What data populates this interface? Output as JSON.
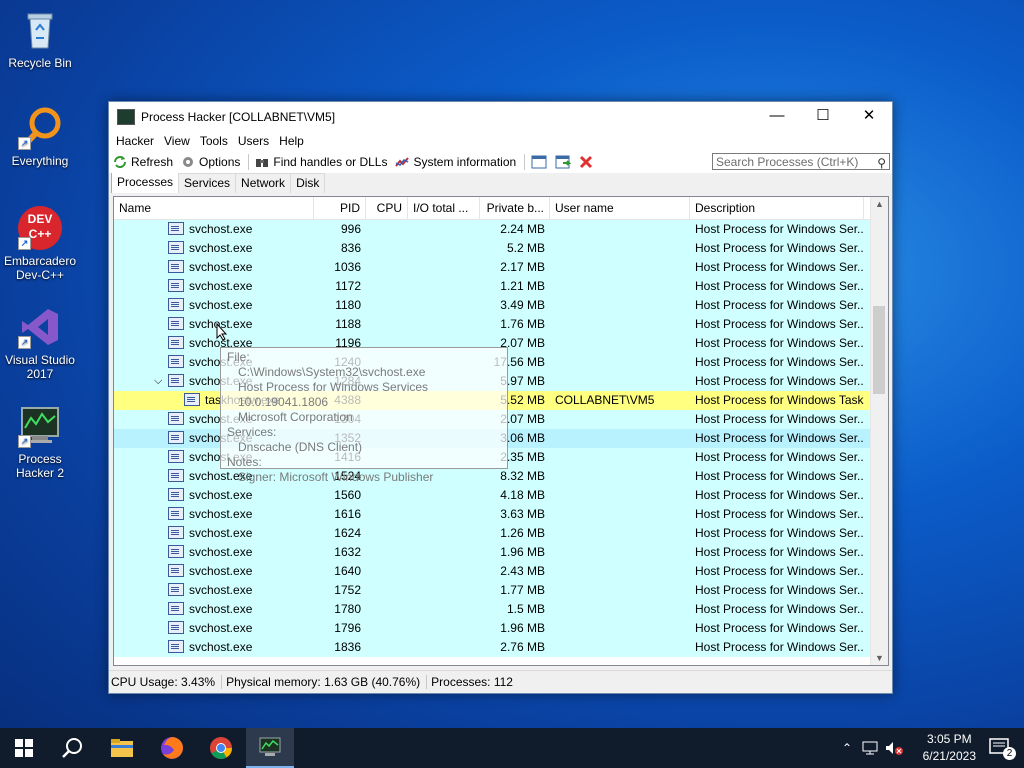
{
  "desktop": [
    {
      "label": "Recycle Bin"
    },
    {
      "label": "Everything"
    },
    {
      "label": "Embarcadero Dev-C++",
      "icon_text": "DEV C++"
    },
    {
      "label": "Visual Studio 2017"
    },
    {
      "label": "Process Hacker 2"
    }
  ],
  "window": {
    "title": "Process Hacker [COLLABNET\\VM5]",
    "controls": {
      "minimize": "—",
      "maximize": "☐",
      "close": "✕"
    }
  },
  "menu": [
    "Hacker",
    "View",
    "Tools",
    "Users",
    "Help"
  ],
  "toolbar": {
    "refresh": "Refresh",
    "options": "Options",
    "find_handles": "Find handles or DLLs",
    "system_info": "System information",
    "search_placeholder": "Search Processes (Ctrl+K)"
  },
  "tabs": [
    "Processes",
    "Services",
    "Network",
    "Disk"
  ],
  "columns": [
    "Name",
    "PID",
    "CPU",
    "I/O total ...",
    "Private b...",
    "User name",
    "Description"
  ],
  "rows": [
    {
      "name": "svchost.exe",
      "pid": "996",
      "priv": "2.24 MB",
      "user": "",
      "desc": "Host Process for Windows Ser..."
    },
    {
      "name": "svchost.exe",
      "pid": "836",
      "priv": "5.2 MB",
      "user": "",
      "desc": "Host Process for Windows Ser..."
    },
    {
      "name": "svchost.exe",
      "pid": "1036",
      "priv": "2.17 MB",
      "user": "",
      "desc": "Host Process for Windows Ser..."
    },
    {
      "name": "svchost.exe",
      "pid": "1172",
      "priv": "1.21 MB",
      "user": "",
      "desc": "Host Process for Windows Ser..."
    },
    {
      "name": "svchost.exe",
      "pid": "1180",
      "priv": "3.49 MB",
      "user": "",
      "desc": "Host Process for Windows Ser..."
    },
    {
      "name": "svchost.exe",
      "pid": "1188",
      "priv": "1.76 MB",
      "user": "",
      "desc": "Host Process for Windows Ser..."
    },
    {
      "name": "svchost.exe",
      "pid": "1196",
      "priv": "2.07 MB",
      "user": "",
      "desc": "Host Process for Windows Ser..."
    },
    {
      "name": "svchost.exe",
      "pid": "1240",
      "priv": "17.56 MB",
      "user": "",
      "desc": "Host Process for Windows Ser..."
    },
    {
      "name": "svchost.exe",
      "pid": "1284",
      "priv": "5.97 MB",
      "user": "",
      "desc": "Host Process for Windows Ser...",
      "expanded": true
    },
    {
      "name": "taskhostw.exe",
      "pid": "4388",
      "priv": "5.52 MB",
      "user": "COLLABNET\\VM5",
      "desc": "Host Process for Windows Tasks",
      "child": true,
      "selected": true
    },
    {
      "name": "svchost.exe",
      "pid": "1304",
      "priv": "2.07 MB",
      "user": "",
      "desc": "Host Process for Windows Ser..."
    },
    {
      "name": "svchost.exe",
      "pid": "1352",
      "priv": "3.06 MB",
      "user": "",
      "desc": "Host Process for Windows Ser...",
      "hover": true
    },
    {
      "name": "svchost.exe",
      "pid": "1416",
      "priv": "2.35 MB",
      "user": "",
      "desc": "Host Process for Windows Ser..."
    },
    {
      "name": "svchost.exe",
      "pid": "1524",
      "priv": "8.32 MB",
      "user": "",
      "desc": "Host Process for Windows Ser..."
    },
    {
      "name": "svchost.exe",
      "pid": "1560",
      "priv": "4.18 MB",
      "user": "",
      "desc": "Host Process for Windows Ser..."
    },
    {
      "name": "svchost.exe",
      "pid": "1616",
      "priv": "3.63 MB",
      "user": "",
      "desc": "Host Process for Windows Ser..."
    },
    {
      "name": "svchost.exe",
      "pid": "1624",
      "priv": "1.26 MB",
      "user": "",
      "desc": "Host Process for Windows Ser..."
    },
    {
      "name": "svchost.exe",
      "pid": "1632",
      "priv": "1.96 MB",
      "user": "",
      "desc": "Host Process for Windows Ser..."
    },
    {
      "name": "svchost.exe",
      "pid": "1640",
      "priv": "2.43 MB",
      "user": "",
      "desc": "Host Process for Windows Ser..."
    },
    {
      "name": "svchost.exe",
      "pid": "1752",
      "priv": "1.77 MB",
      "user": "",
      "desc": "Host Process for Windows Ser..."
    },
    {
      "name": "svchost.exe",
      "pid": "1780",
      "priv": "1.5 MB",
      "user": "",
      "desc": "Host Process for Windows Ser..."
    },
    {
      "name": "svchost.exe",
      "pid": "1796",
      "priv": "1.96 MB",
      "user": "",
      "desc": "Host Process for Windows Ser..."
    },
    {
      "name": "svchost.exe",
      "pid": "1836",
      "priv": "2.76 MB",
      "user": "",
      "desc": "Host Process for Windows Ser..."
    }
  ],
  "tooltip": {
    "file_label": "File:",
    "file_path": "C:\\Windows\\System32\\svchost.exe",
    "file_desc": "Host Process for Windows Services 10.0.19041.1806",
    "company": "Microsoft Corporation",
    "services_label": "Services:",
    "service": "Dnscache (DNS Client)",
    "notes_label": "Notes:",
    "signer": "Signer: Microsoft Windows Publisher"
  },
  "status": {
    "cpu": "CPU Usage: 3.43%",
    "memory": "Physical memory: 1.63 GB (40.76%)",
    "processes": "Processes: 112"
  },
  "taskbar": {
    "time": "3:05 PM",
    "date": "6/21/2023",
    "notifications": "2"
  }
}
